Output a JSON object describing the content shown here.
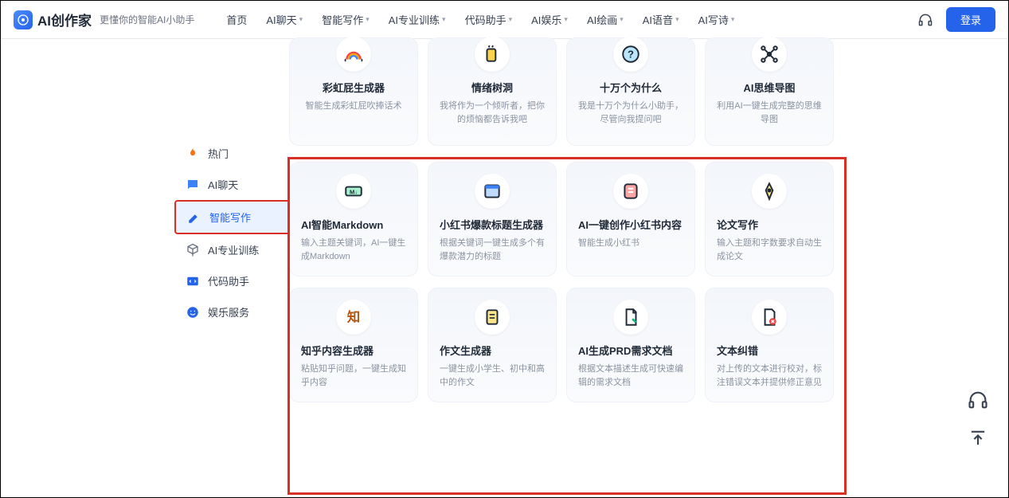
{
  "header": {
    "brand": "AI创作家",
    "slogan": "更懂你的智能AI小助手",
    "nav": [
      "首页",
      "AI聊天",
      "智能写作",
      "AI专业训练",
      "代码助手",
      "AI娱乐",
      "AI绘画",
      "AI语音",
      "AI写诗"
    ],
    "nav_has_chevron": [
      false,
      true,
      true,
      true,
      true,
      true,
      true,
      true,
      true
    ],
    "login": "登录"
  },
  "sidebar": {
    "items": [
      {
        "icon": "fire",
        "label": "热门",
        "color": "#f97316"
      },
      {
        "icon": "chat",
        "label": "AI聊天",
        "color": "#2563eb"
      },
      {
        "icon": "edit",
        "label": "智能写作",
        "color": "#2563eb",
        "active": true
      },
      {
        "icon": "cube",
        "label": "AI专业训练",
        "color": "#6b7280"
      },
      {
        "icon": "code",
        "label": "代码助手",
        "color": "#2563eb"
      },
      {
        "icon": "smile",
        "label": "娱乐服务",
        "color": "#2563eb"
      }
    ]
  },
  "cards_row0": [
    {
      "title": "彩虹屁生成器",
      "desc": "智能生成彩虹屁吹捧话术"
    },
    {
      "title": "情绪树洞",
      "desc": "我将作为一个倾听者，把你的烦恼都告诉我吧"
    },
    {
      "title": "十万个为什么",
      "desc": "我是十万个为什么小助手，尽管向我提问吧"
    },
    {
      "title": "AI思维导图",
      "desc": "利用AI一键生成完整的思维导图"
    }
  ],
  "cards_row1": [
    {
      "title": "AI智能Markdown",
      "desc": "输入主题关键词，AI一键生成Markdown"
    },
    {
      "title": "小红书爆款标题生成器",
      "desc": "根据关键词一键生成多个有爆款潜力的标题"
    },
    {
      "title": "AI一键创作小红书内容",
      "desc": "智能生成小红书"
    },
    {
      "title": "论文写作",
      "desc": "输入主题和字数要求自动生成论文"
    }
  ],
  "cards_row2": [
    {
      "title": "知乎内容生成器",
      "desc": "粘贴知乎问题，一键生成知乎内容"
    },
    {
      "title": "作文生成器",
      "desc": "一键生成小学生、初中和高中的作文"
    },
    {
      "title": "AI生成PRD需求文档",
      "desc": "根据文本描述生成可快速编辑的需求文档"
    },
    {
      "title": "文本纠错",
      "desc": "对上传的文本进行校对，标注错误文本并提供修正意见"
    }
  ]
}
